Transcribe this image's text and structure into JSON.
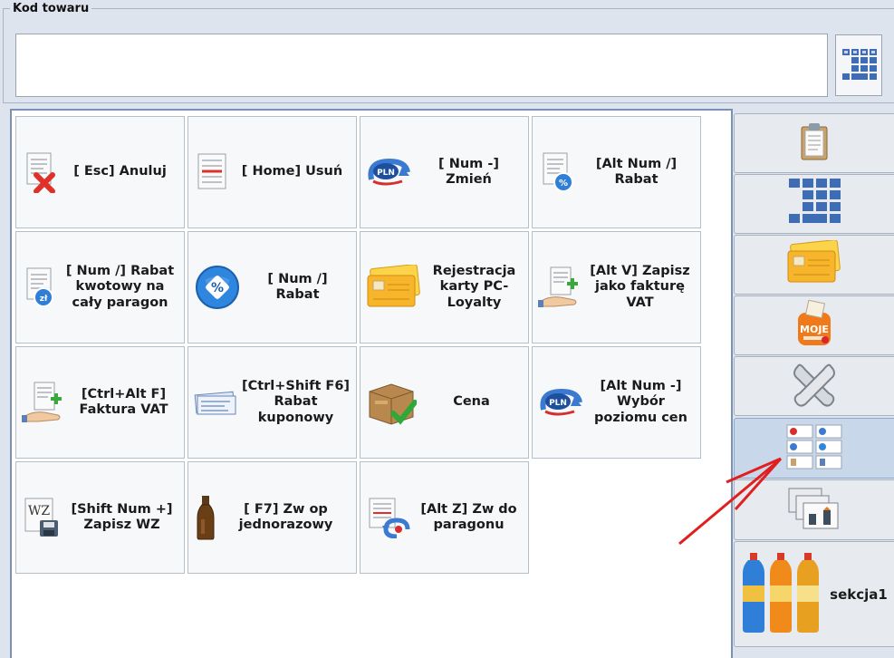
{
  "product_code": {
    "legend": "Kod towaru",
    "value": "",
    "keypad_icon": "keypad-icon"
  },
  "tiles": [
    {
      "label": "[ Esc] Anuluj",
      "icon": "cancel-document-icon"
    },
    {
      "label": "[ Home] Usuń",
      "icon": "delete-document-icon"
    },
    {
      "label": "[ Num -] Zmień",
      "icon": "currency-change-icon"
    },
    {
      "label": "[Alt Num /] Rabat",
      "icon": "discount-document-icon"
    },
    {
      "label": "[ Num /] Rabat kwotowy na cały paragon",
      "icon": "amount-discount-icon"
    },
    {
      "label": "[ Num /] Rabat",
      "icon": "percent-icon"
    },
    {
      "label": "Rejestracja karty PC-Loyalty",
      "icon": "loyalty-card-icon"
    },
    {
      "label": "[Alt V] Zapisz jako fakturę VAT",
      "icon": "invoice-hand-icon"
    },
    {
      "label": "[Ctrl+Alt F] Faktura VAT",
      "icon": "invoice-hand-icon"
    },
    {
      "label": "[Ctrl+Shift F6] Rabat kuponowy",
      "icon": "coupon-icon"
    },
    {
      "label": "Cena",
      "icon": "price-box-icon"
    },
    {
      "label": "[Alt Num -] Wybór poziomu cen",
      "icon": "price-level-icon"
    },
    {
      "label": "[Shift Num +] Zapisz WZ",
      "icon": "save-wz-icon"
    },
    {
      "label": "[ F7] Zw op jednorazowy",
      "icon": "bottle-icon"
    },
    {
      "label": "[Alt Z] Zw do paragonu",
      "icon": "return-receipt-icon"
    }
  ],
  "side_tabs": [
    {
      "icon": "clipboard-icon",
      "label": ""
    },
    {
      "icon": "keypad-icon",
      "label": ""
    },
    {
      "icon": "loyalty-card-icon",
      "label": ""
    },
    {
      "icon": "moje-rabatujnki-icon",
      "label": ""
    },
    {
      "icon": "tools-icon",
      "label": ""
    },
    {
      "icon": "functions-grid-icon",
      "label": "",
      "active": true
    },
    {
      "icon": "gallery-icon",
      "label": ""
    },
    {
      "icon": "bottles-icon",
      "label": "sekcja1"
    }
  ],
  "colors": {
    "background": "#dee4ed",
    "tile": "#f6f8fa",
    "active_tab": "#c9d7ea",
    "arrow": "#e02020"
  }
}
